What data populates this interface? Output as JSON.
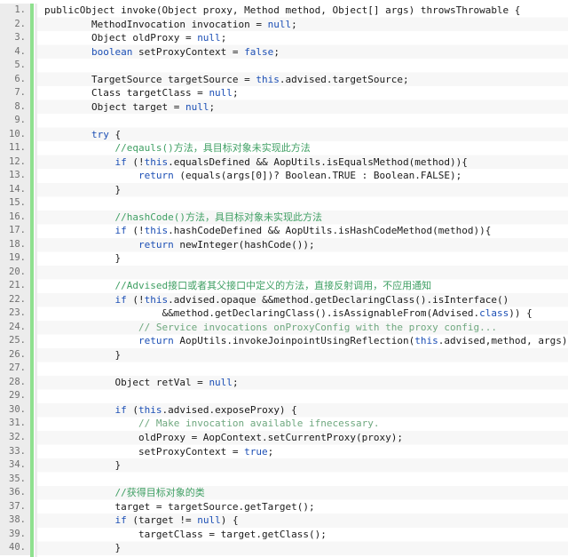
{
  "editor": {
    "name": "java-source-viewer",
    "language": "Java",
    "gutter_background": "#ececec",
    "rail_color": "#8fe08f",
    "keyword_color": "#1c4fb5",
    "comment_color": "#3f9f63",
    "english_comment_color": "#6fa87f",
    "text_color": "#1a1a1a",
    "stripe_color": "#f7f7f7",
    "first_line": 1,
    "last_line": 40
  },
  "line_numbers": [
    "1.",
    "2.",
    "3.",
    "4.",
    "5.",
    "6.",
    "7.",
    "8.",
    "9.",
    "10.",
    "11.",
    "12.",
    "13.",
    "14.",
    "15.",
    "16.",
    "17.",
    "18.",
    "19.",
    "20.",
    "21.",
    "22.",
    "23.",
    "24.",
    "25.",
    "26.",
    "27.",
    "28.",
    "29.",
    "30.",
    "31.",
    "32.",
    "33.",
    "34.",
    "35.",
    "36.",
    "37.",
    "38.",
    "39.",
    "40."
  ],
  "code_lines": [
    {
      "n": 1,
      "tokens": [
        {
          "t": "plain",
          "s": "publicObject invoke(Object proxy, Method method, Object[] args) throwsThrowable {"
        }
      ]
    },
    {
      "n": 2,
      "tokens": [
        {
          "t": "plain",
          "s": "        MethodInvocation invocation = "
        },
        {
          "t": "kw",
          "s": "null"
        },
        {
          "t": "plain",
          "s": ";"
        }
      ]
    },
    {
      "n": 3,
      "tokens": [
        {
          "t": "plain",
          "s": "        Object oldProxy = "
        },
        {
          "t": "kw",
          "s": "null"
        },
        {
          "t": "plain",
          "s": ";"
        }
      ]
    },
    {
      "n": 4,
      "tokens": [
        {
          "t": "plain",
          "s": "        "
        },
        {
          "t": "kw",
          "s": "boolean"
        },
        {
          "t": "plain",
          "s": " setProxyContext = "
        },
        {
          "t": "kw",
          "s": "false"
        },
        {
          "t": "plain",
          "s": ";"
        }
      ]
    },
    {
      "n": 5,
      "tokens": [
        {
          "t": "plain",
          "s": ""
        }
      ]
    },
    {
      "n": 6,
      "tokens": [
        {
          "t": "plain",
          "s": "        TargetSource targetSource = "
        },
        {
          "t": "kw",
          "s": "this"
        },
        {
          "t": "plain",
          "s": ".advised.targetSource;"
        }
      ]
    },
    {
      "n": 7,
      "tokens": [
        {
          "t": "plain",
          "s": "        Class targetClass = "
        },
        {
          "t": "kw",
          "s": "null"
        },
        {
          "t": "plain",
          "s": ";"
        }
      ]
    },
    {
      "n": 8,
      "tokens": [
        {
          "t": "plain",
          "s": "        Object target = "
        },
        {
          "t": "kw",
          "s": "null"
        },
        {
          "t": "plain",
          "s": ";"
        }
      ]
    },
    {
      "n": 9,
      "tokens": [
        {
          "t": "plain",
          "s": ""
        }
      ]
    },
    {
      "n": 10,
      "tokens": [
        {
          "t": "plain",
          "s": "        "
        },
        {
          "t": "kw",
          "s": "try"
        },
        {
          "t": "plain",
          "s": " {"
        }
      ]
    },
    {
      "n": 11,
      "tokens": [
        {
          "t": "plain",
          "s": "            "
        },
        {
          "t": "cm",
          "s": "//eqauls()方法，具目标对象未实现此方法"
        }
      ]
    },
    {
      "n": 12,
      "tokens": [
        {
          "t": "plain",
          "s": "            "
        },
        {
          "t": "kw",
          "s": "if"
        },
        {
          "t": "plain",
          "s": " (!"
        },
        {
          "t": "kw",
          "s": "this"
        },
        {
          "t": "plain",
          "s": ".equalsDefined && AopUtils.isEqualsMethod(method)){"
        }
      ]
    },
    {
      "n": 13,
      "tokens": [
        {
          "t": "plain",
          "s": "                "
        },
        {
          "t": "kw",
          "s": "return"
        },
        {
          "t": "plain",
          "s": " (equals(args[0])? Boolean.TRUE : Boolean.FALSE);"
        }
      ]
    },
    {
      "n": 14,
      "tokens": [
        {
          "t": "plain",
          "s": "            }"
        }
      ]
    },
    {
      "n": 15,
      "tokens": [
        {
          "t": "plain",
          "s": ""
        }
      ]
    },
    {
      "n": 16,
      "tokens": [
        {
          "t": "plain",
          "s": "            "
        },
        {
          "t": "cm",
          "s": "//hashCode()方法，具目标对象未实现此方法"
        }
      ]
    },
    {
      "n": 17,
      "tokens": [
        {
          "t": "plain",
          "s": "            "
        },
        {
          "t": "kw",
          "s": "if"
        },
        {
          "t": "plain",
          "s": " (!"
        },
        {
          "t": "kw",
          "s": "this"
        },
        {
          "t": "plain",
          "s": ".hashCodeDefined && AopUtils.isHashCodeMethod(method)){"
        }
      ]
    },
    {
      "n": 18,
      "tokens": [
        {
          "t": "plain",
          "s": "                "
        },
        {
          "t": "kw",
          "s": "return"
        },
        {
          "t": "plain",
          "s": " newInteger(hashCode());"
        }
      ]
    },
    {
      "n": 19,
      "tokens": [
        {
          "t": "plain",
          "s": "            }"
        }
      ]
    },
    {
      "n": 20,
      "tokens": [
        {
          "t": "plain",
          "s": ""
        }
      ]
    },
    {
      "n": 21,
      "tokens": [
        {
          "t": "plain",
          "s": "            "
        },
        {
          "t": "cm",
          "s": "//Advised接口或者其父接口中定义的方法，直接反射调用，不应用通知"
        }
      ]
    },
    {
      "n": 22,
      "tokens": [
        {
          "t": "plain",
          "s": "            "
        },
        {
          "t": "kw",
          "s": "if"
        },
        {
          "t": "plain",
          "s": " (!"
        },
        {
          "t": "kw",
          "s": "this"
        },
        {
          "t": "plain",
          "s": ".advised.opaque &&method.getDeclaringClass().isInterface()"
        }
      ]
    },
    {
      "n": 23,
      "tokens": [
        {
          "t": "plain",
          "s": "                    &&method.getDeclaringClass().isAssignableFrom(Advised."
        },
        {
          "t": "kw",
          "s": "class"
        },
        {
          "t": "plain",
          "s": ")) {"
        }
      ]
    },
    {
      "n": 24,
      "tokens": [
        {
          "t": "plain",
          "s": "                "
        },
        {
          "t": "cmen",
          "s": "// Service invocations onProxyConfig with the proxy config..."
        }
      ]
    },
    {
      "n": 25,
      "tokens": [
        {
          "t": "plain",
          "s": "                "
        },
        {
          "t": "kw",
          "s": "return"
        },
        {
          "t": "plain",
          "s": " AopUtils.invokeJoinpointUsingReflection("
        },
        {
          "t": "kw",
          "s": "this"
        },
        {
          "t": "plain",
          "s": ".advised,method, args);"
        }
      ]
    },
    {
      "n": 26,
      "tokens": [
        {
          "t": "plain",
          "s": "            }"
        }
      ]
    },
    {
      "n": 27,
      "tokens": [
        {
          "t": "plain",
          "s": ""
        }
      ]
    },
    {
      "n": 28,
      "tokens": [
        {
          "t": "plain",
          "s": "            Object retVal = "
        },
        {
          "t": "kw",
          "s": "null"
        },
        {
          "t": "plain",
          "s": ";"
        }
      ]
    },
    {
      "n": 29,
      "tokens": [
        {
          "t": "plain",
          "s": ""
        }
      ]
    },
    {
      "n": 30,
      "tokens": [
        {
          "t": "plain",
          "s": "            "
        },
        {
          "t": "kw",
          "s": "if"
        },
        {
          "t": "plain",
          "s": " ("
        },
        {
          "t": "kw",
          "s": "this"
        },
        {
          "t": "plain",
          "s": ".advised.exposeProxy) {"
        }
      ]
    },
    {
      "n": 31,
      "tokens": [
        {
          "t": "plain",
          "s": "                "
        },
        {
          "t": "cmen",
          "s": "// Make invocation available ifnecessary."
        }
      ]
    },
    {
      "n": 32,
      "tokens": [
        {
          "t": "plain",
          "s": "                oldProxy = AopContext.setCurrentProxy(proxy);"
        }
      ]
    },
    {
      "n": 33,
      "tokens": [
        {
          "t": "plain",
          "s": "                setProxyContext = "
        },
        {
          "t": "kw",
          "s": "true"
        },
        {
          "t": "plain",
          "s": ";"
        }
      ]
    },
    {
      "n": 34,
      "tokens": [
        {
          "t": "plain",
          "s": "            }"
        }
      ]
    },
    {
      "n": 35,
      "tokens": [
        {
          "t": "plain",
          "s": ""
        }
      ]
    },
    {
      "n": 36,
      "tokens": [
        {
          "t": "plain",
          "s": "            "
        },
        {
          "t": "cm",
          "s": "//获得目标对象的类"
        }
      ]
    },
    {
      "n": 37,
      "tokens": [
        {
          "t": "plain",
          "s": "            target = targetSource.getTarget();"
        }
      ]
    },
    {
      "n": 38,
      "tokens": [
        {
          "t": "plain",
          "s": "            "
        },
        {
          "t": "kw",
          "s": "if"
        },
        {
          "t": "plain",
          "s": " (target != "
        },
        {
          "t": "kw",
          "s": "null"
        },
        {
          "t": "plain",
          "s": ") {"
        }
      ]
    },
    {
      "n": 39,
      "tokens": [
        {
          "t": "plain",
          "s": "                targetClass = target.getClass();"
        }
      ]
    },
    {
      "n": 40,
      "tokens": [
        {
          "t": "plain",
          "s": "            }"
        }
      ]
    }
  ]
}
